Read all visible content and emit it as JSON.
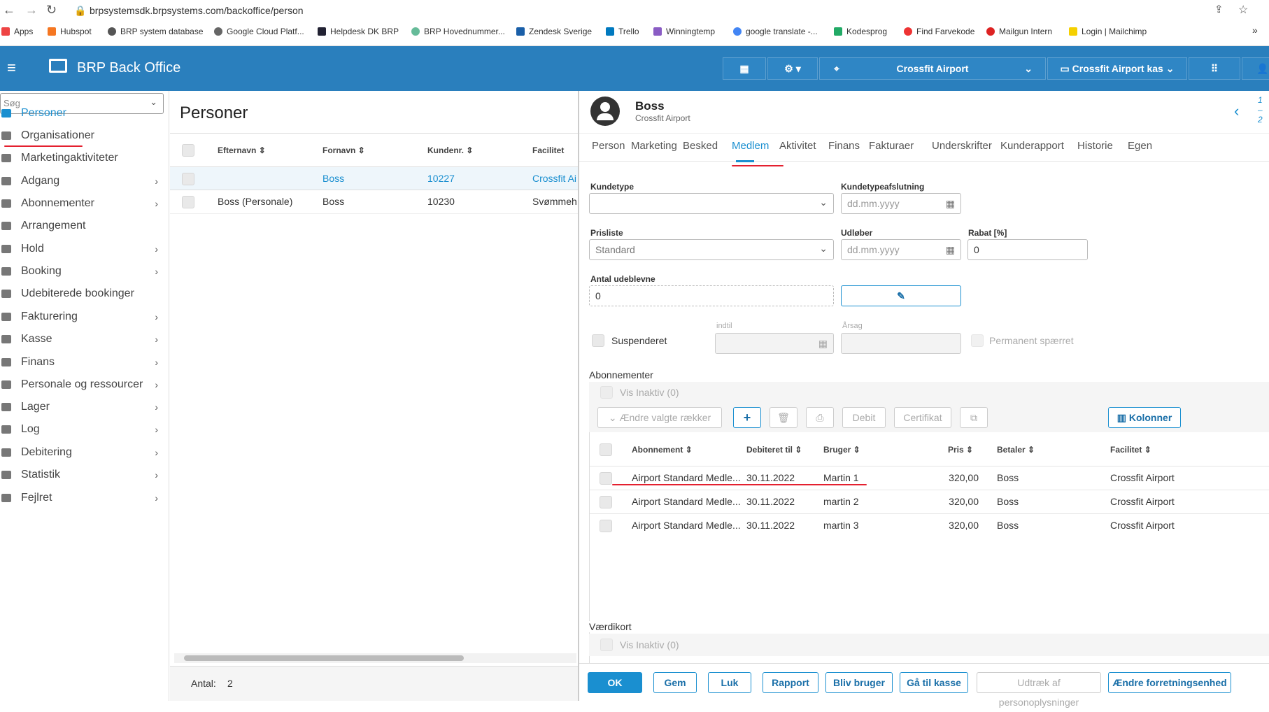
{
  "browser": {
    "url": "brpsystemsdk.brpsystems.com/backoffice/person",
    "bookmarks": [
      "Apps",
      "Hubspot",
      "BRP system database",
      "Google Cloud Platf...",
      "Helpdesk DK BRP",
      "BRP Hovednummer...",
      "Zendesk Sverige",
      "Trello",
      "Winningtemp",
      "google translate -...",
      "Kodesprog",
      "Find Farvekode",
      "Mailgun Intern",
      "Login | Mailchimp"
    ],
    "more": "»"
  },
  "app": {
    "title": "BRP Back Office",
    "location": "Crossfit Airport",
    "register": "Crossfit Airport kas"
  },
  "sidebar": {
    "search_placeholder": "Søg",
    "items": [
      {
        "label": "Personer",
        "chev": ""
      },
      {
        "label": "Organisationer",
        "chev": ""
      },
      {
        "label": "Marketingaktiviteter",
        "chev": ""
      },
      {
        "label": "Adgang",
        "chev": "›"
      },
      {
        "label": "Abonnementer",
        "chev": "›"
      },
      {
        "label": "Arrangement",
        "chev": ""
      },
      {
        "label": "Hold",
        "chev": "›"
      },
      {
        "label": "Booking",
        "chev": "›"
      },
      {
        "label": "Udebiterede bookinger",
        "chev": ""
      },
      {
        "label": "Fakturering",
        "chev": "›"
      },
      {
        "label": "Kasse",
        "chev": "›"
      },
      {
        "label": "Finans",
        "chev": "›"
      },
      {
        "label": "Personale og ressourcer",
        "chev": "›"
      },
      {
        "label": "Lager",
        "chev": "›"
      },
      {
        "label": "Log",
        "chev": "›"
      },
      {
        "label": "Debitering",
        "chev": "›"
      },
      {
        "label": "Statistik",
        "chev": "›"
      },
      {
        "label": "Fejlret",
        "chev": "›"
      }
    ]
  },
  "persons": {
    "title": "Personer",
    "columns": [
      "Efternavn",
      "Fornavn",
      "Kundenr.",
      "Facilitet"
    ],
    "rows": [
      {
        "efternavn": "",
        "fornavn": "Boss",
        "kundenr": "10227",
        "facilitet": "Crossfit Ai"
      },
      {
        "efternavn": "Boss (Personale)",
        "fornavn": "Boss",
        "kundenr": "10230",
        "facilitet": "Svømmeh"
      }
    ],
    "count_label": "Antal:",
    "count": "2"
  },
  "detail": {
    "name": "Boss",
    "sub": "Crossfit Airport",
    "pager": [
      "1",
      "–",
      "2"
    ],
    "tabs": [
      "Person",
      "Marketing",
      "Besked",
      "Medlem",
      "Aktivitet",
      "Finans",
      "Fakturaer",
      "Underskrifter",
      "Kunderapport",
      "Historie",
      "Egen"
    ],
    "fields": {
      "kundetype_label": "Kundetype",
      "kundetypeafslutning_label": "Kundetypeafslutning",
      "date_ph": "dd.mm.yyyy",
      "prisliste_label": "Prisliste",
      "prisliste_value": "Standard",
      "udlober_label": "Udløber",
      "rabat_label": "Rabat [%]",
      "rabat_value": "0",
      "antal_label": "Antal udeblevne",
      "antal_value": "0",
      "suspenderet": "Suspenderet",
      "indtil": "indtil",
      "arsag": "Årsag",
      "permanent": "Permanent spærret"
    },
    "abonnementer": {
      "title": "Abonnementer",
      "vis_inaktiv": "Vis Inaktiv (0)",
      "aendre": "Ændre valgte rækker",
      "debit": "Debit",
      "certifikat": "Certifikat",
      "kolonner": "Kolonner",
      "columns": [
        "Abonnement",
        "Debiteret til",
        "Bruger",
        "Pris",
        "Betaler",
        "Facilitet"
      ],
      "rows": [
        {
          "abonnement": "Airport Standard Medle...",
          "debiteret": "30.11.2022",
          "bruger": "Martin 1",
          "pris": "320,00",
          "betaler": "Boss",
          "facilitet": "Crossfit Airport"
        },
        {
          "abonnement": "Airport Standard Medle...",
          "debiteret": "30.11.2022",
          "bruger": "martin 2",
          "pris": "320,00",
          "betaler": "Boss",
          "facilitet": "Crossfit Airport"
        },
        {
          "abonnement": "Airport Standard Medle...",
          "debiteret": "30.11.2022",
          "bruger": "martin 3",
          "pris": "320,00",
          "betaler": "Boss",
          "facilitet": "Crossfit Airport"
        }
      ]
    },
    "vaerdikort": {
      "title": "Værdikort",
      "vis_inaktiv": "Vis Inaktiv (0)"
    },
    "footer": [
      "OK",
      "Gem",
      "Luk",
      "Rapport",
      "Bliv bruger",
      "Gå til kasse",
      "Udtræk af personoplysninger",
      "Ændre forretningsenhed"
    ]
  }
}
